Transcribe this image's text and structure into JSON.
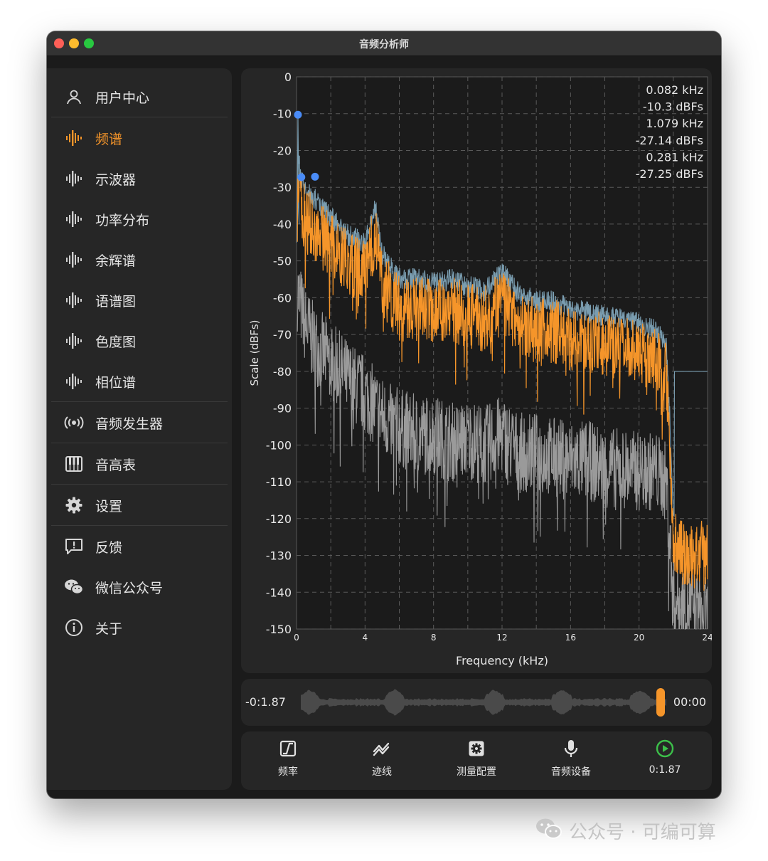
{
  "window": {
    "title": "音频分析师"
  },
  "sidebar": {
    "items": [
      {
        "label": "用户中心",
        "icon": "person-icon",
        "active": false
      },
      {
        "label": "频谱",
        "icon": "waveform-icon",
        "active": true
      },
      {
        "label": "示波器",
        "icon": "waveform-icon",
        "active": false
      },
      {
        "label": "功率分布",
        "icon": "waveform-icon",
        "active": false
      },
      {
        "label": "余辉谱",
        "icon": "waveform-icon",
        "active": false
      },
      {
        "label": "语谱图",
        "icon": "waveform-icon",
        "active": false
      },
      {
        "label": "色度图",
        "icon": "waveform-icon",
        "active": false
      },
      {
        "label": "相位谱",
        "icon": "waveform-icon",
        "active": false
      },
      {
        "label": "音频发生器",
        "icon": "broadcast-icon",
        "active": false
      },
      {
        "label": "音高表",
        "icon": "piano-icon",
        "active": false
      },
      {
        "label": "设置",
        "icon": "gear-icon",
        "active": false
      },
      {
        "label": "反馈",
        "icon": "feedback-icon",
        "active": false
      },
      {
        "label": "微信公众号",
        "icon": "wechat-icon",
        "active": false
      },
      {
        "label": "关于",
        "icon": "info-icon",
        "active": false
      }
    ]
  },
  "colors": {
    "accent": "#f5952a",
    "marker": "#4a8cf7",
    "play": "#3cc04a",
    "grey_trace": "#9a9a9a",
    "peak_trace": "#7a9db0"
  },
  "chart_data": {
    "type": "line",
    "xlabel": "Frequency (kHz)",
    "ylabel": "Scale (dBFs)",
    "xlim": [
      0,
      24
    ],
    "ylim": [
      -150,
      0
    ],
    "xticks": [
      "0",
      "4",
      "8",
      "12",
      "16",
      "20",
      "24"
    ],
    "yticks": [
      "0",
      "-10",
      "-20",
      "-30",
      "-40",
      "-50",
      "-60",
      "-70",
      "-80",
      "-90",
      "-100",
      "-110",
      "-120",
      "-130",
      "-140",
      "-150"
    ],
    "grid": true,
    "readout": [
      "0.082 kHz",
      "-10.3 dBFs",
      "1.079 kHz",
      "-27.14 dBFs",
      "0.281 kHz",
      "-27.25 dBFs"
    ],
    "markers": [
      {
        "x": 0.082,
        "y": -10.3
      },
      {
        "x": 0.281,
        "y": -27.25
      },
      {
        "x": 1.079,
        "y": -27.14
      }
    ],
    "series": [
      {
        "color": "#f5952a",
        "x": [
          0,
          0.1,
          0.5,
          1,
          2,
          3,
          4,
          4.6,
          5,
          6,
          7,
          8,
          9,
          10,
          11,
          12,
          13,
          14,
          15,
          16,
          17,
          18,
          19,
          20,
          21,
          21.6,
          21.8,
          22,
          23,
          24
        ],
        "y": [
          -40,
          -30,
          -38,
          -40,
          -45,
          -50,
          -52,
          -42,
          -55,
          -62,
          -62,
          -63,
          -62,
          -64,
          -65,
          -60,
          -66,
          -68,
          -68,
          -70,
          -71,
          -72,
          -73,
          -74,
          -76,
          -80,
          -100,
          -125,
          -130,
          -128
        ]
      },
      {
        "color": "#9a9a9a",
        "x": [
          0,
          0.5,
          1,
          2,
          3,
          4,
          5,
          6,
          7,
          8,
          9,
          10,
          11,
          12,
          13,
          14,
          15,
          16,
          17,
          18,
          19,
          20,
          21,
          21.6,
          21.8,
          22,
          23,
          24
        ],
        "y": [
          -55,
          -65,
          -70,
          -75,
          -80,
          -84,
          -90,
          -93,
          -95,
          -95,
          -97,
          -96,
          -98,
          -95,
          -100,
          -100,
          -101,
          -102,
          -102,
          -104,
          -104,
          -105,
          -105,
          -108,
          -125,
          -140,
          -142,
          -145
        ]
      }
    ]
  },
  "scrubber": {
    "elapsed": "-0:1.87",
    "remaining": "00:00",
    "progress": 0.985
  },
  "toolbar": {
    "items": [
      {
        "label": "频率",
        "icon": "frequency-icon"
      },
      {
        "label": "迹线",
        "icon": "trace-icon"
      },
      {
        "label": "测量配置",
        "icon": "measure-config-icon"
      },
      {
        "label": "音频设备",
        "icon": "microphone-icon"
      },
      {
        "label": "0:1.87",
        "icon": "play-icon"
      }
    ]
  },
  "watermark": {
    "text": "公众号 · 可编可算"
  }
}
